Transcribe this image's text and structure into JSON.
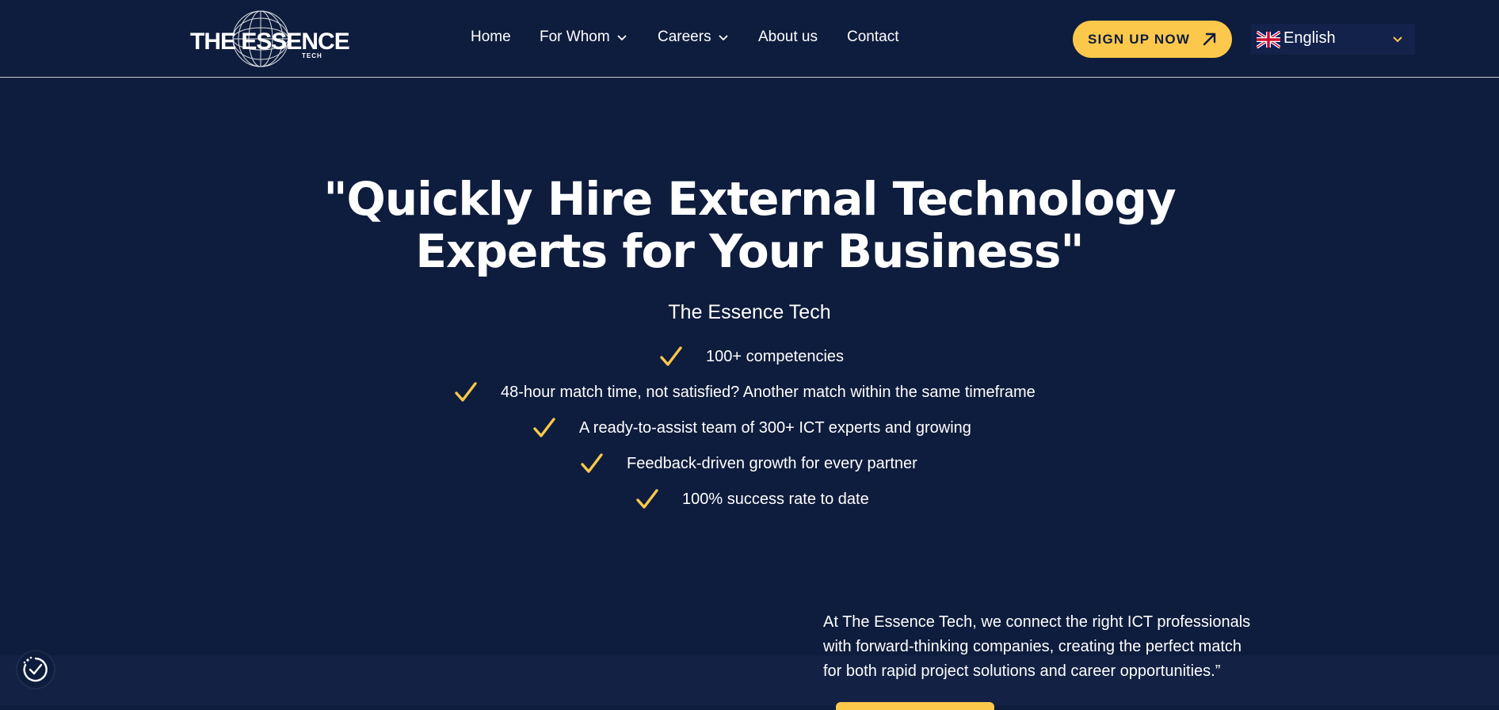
{
  "brand": {
    "name": "THE ESSENCE",
    "sub": "TECH"
  },
  "nav": {
    "items": [
      {
        "label": "Home"
      },
      {
        "label": "For Whom"
      },
      {
        "label": "Careers"
      },
      {
        "label": "About us"
      },
      {
        "label": "Contact"
      }
    ]
  },
  "header": {
    "signup_label": "SIGN UP NOW",
    "language": "English"
  },
  "hero": {
    "title_line1": "\"Quickly Hire External Technology",
    "title_line2": "Experts for Your Business\"",
    "subtitle": "The Essence Tech",
    "features": [
      "100+ competencies",
      "48-hour match time, not satisfied? Another match within the same timeframe",
      "A ready-to-assist team of 300+ ICT experts and growing",
      "Feedback-driven growth for every partner",
      "100% success rate to date"
    ]
  },
  "about": {
    "quote_line1": "At The Essence Tech, we connect the right ICT professionals",
    "quote_line2": "with forward-thinking companies, creating the perfect match",
    "quote_line3": "for both rapid project solutions and career opportunities.”"
  },
  "colors": {
    "background": "#0e1c3d",
    "accent": "#fbc84b",
    "text": "#ffffff"
  },
  "icons": {
    "signup": "arrow-up-right-icon",
    "language_flag": "uk-flag-icon",
    "feature": "checkmark-icon",
    "accessibility": "accessibility-icon"
  }
}
